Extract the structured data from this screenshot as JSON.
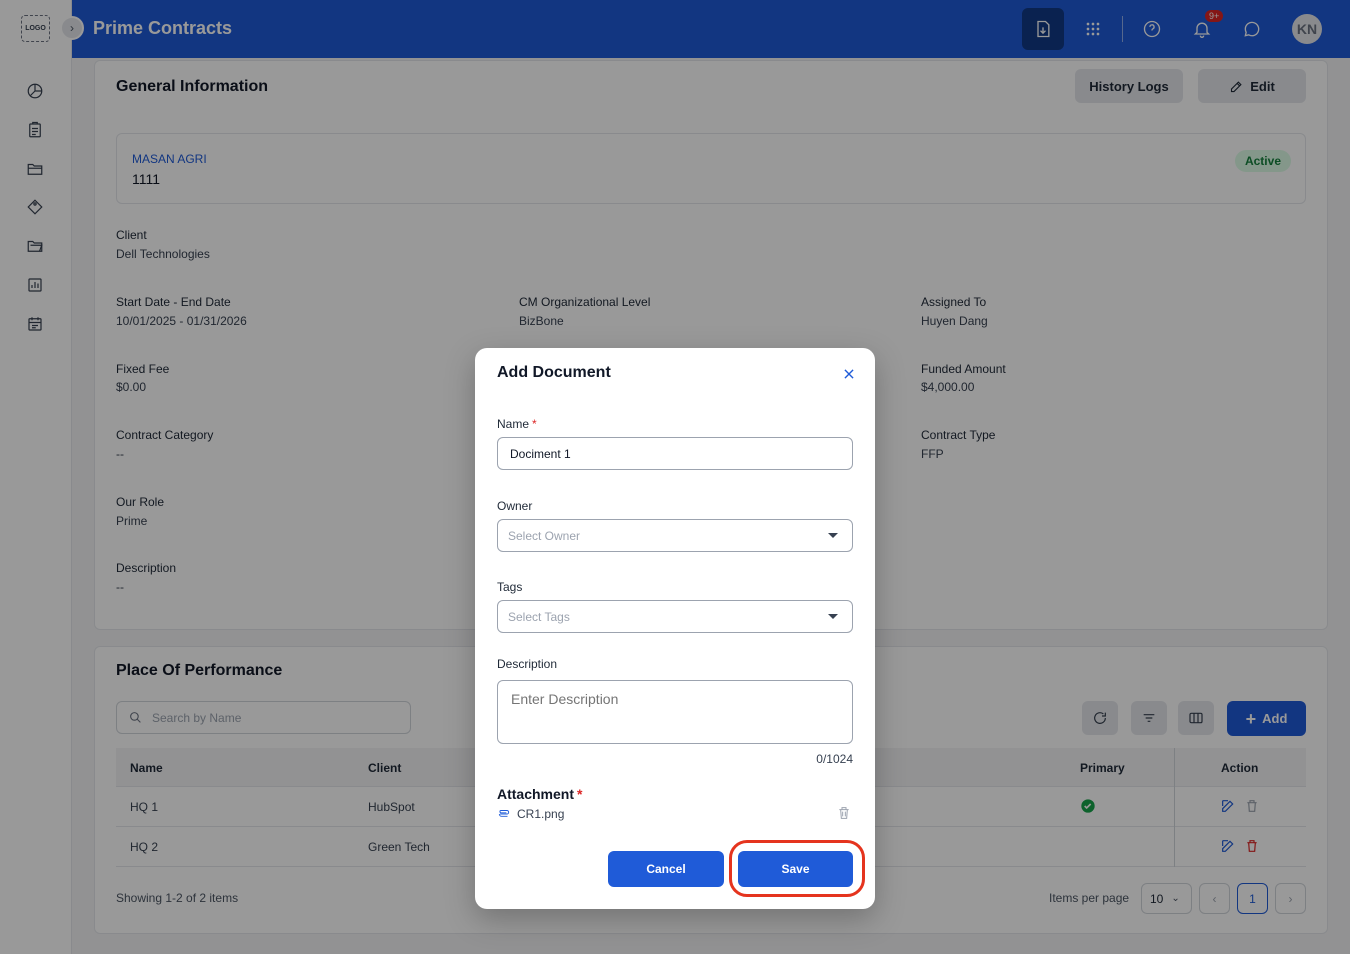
{
  "app": {
    "logo_text": "LOGO",
    "title": "Prime Contracts",
    "notification_count": "9+",
    "avatar_initials": "KN"
  },
  "general_info": {
    "title": "General Information",
    "history_logs_label": "History Logs",
    "edit_label": "Edit",
    "client_name": "MASAN AGRI",
    "contract_number": "1111",
    "status": "Active",
    "fields": {
      "client_label": "Client",
      "client_value": "Dell Technologies",
      "dates_label": "Start Date - End Date",
      "dates_value": "10/01/2025 - 01/31/2026",
      "org_level_label": "CM Organizational Level",
      "org_level_value": "BizBone",
      "assigned_label": "Assigned To",
      "assigned_value": "Huyen Dang",
      "fixed_fee_label": "Fixed Fee",
      "fixed_fee_value": "$0.00",
      "funded_label": "Funded Amount",
      "funded_value": "$4,000.00",
      "category_label": "Contract Category",
      "category_value": "--",
      "type_label": "Contract Type",
      "type_value": "FFP",
      "role_label": "Our Role",
      "role_value": "Prime",
      "description_label": "Description",
      "description_value": "--"
    }
  },
  "performance": {
    "title": "Place Of Performance",
    "search_placeholder": "Search by Name",
    "add_label": "Add",
    "columns": {
      "name": "Name",
      "client": "Client",
      "primary": "Primary",
      "action": "Action"
    },
    "rows": [
      {
        "name": "HQ 1",
        "client": "HubSpot",
        "primary": true
      },
      {
        "name": "HQ 2",
        "client": "Green Tech",
        "primary": false
      }
    ],
    "showing": "Showing 1-2 of 2 items",
    "items_per_page_label": "Items per page",
    "items_per_page": "10",
    "current_page": "1"
  },
  "modal": {
    "title": "Add Document",
    "name_label": "Name",
    "name_value": "Dociment 1",
    "owner_label": "Owner",
    "owner_placeholder": "Select Owner",
    "tags_label": "Tags",
    "tags_placeholder": "Select Tags",
    "description_label": "Description",
    "description_placeholder": "Enter Description",
    "char_count": "0/1024",
    "attachment_label": "Attachment",
    "attachment_file": "CR1.png",
    "cancel_label": "Cancel",
    "save_label": "Save",
    "required_mark": "*"
  },
  "colors": {
    "primary": "#1f5bd8",
    "header": "#1f5bd8",
    "danger": "#dc2626",
    "success": "#16a34a",
    "highlight": "#e5341e"
  }
}
